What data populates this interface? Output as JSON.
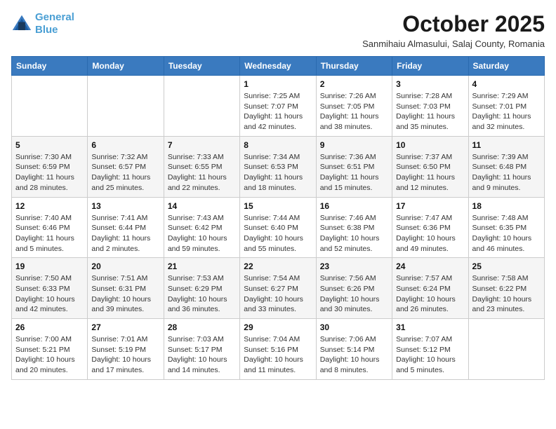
{
  "header": {
    "logo_line1": "General",
    "logo_line2": "Blue",
    "month_title": "October 2025",
    "subtitle": "Sanmihaiu Almasului, Salaj County, Romania"
  },
  "days_of_week": [
    "Sunday",
    "Monday",
    "Tuesday",
    "Wednesday",
    "Thursday",
    "Friday",
    "Saturday"
  ],
  "weeks": [
    [
      {
        "day": "",
        "info": ""
      },
      {
        "day": "",
        "info": ""
      },
      {
        "day": "",
        "info": ""
      },
      {
        "day": "1",
        "info": "Sunrise: 7:25 AM\nSunset: 7:07 PM\nDaylight: 11 hours and 42 minutes."
      },
      {
        "day": "2",
        "info": "Sunrise: 7:26 AM\nSunset: 7:05 PM\nDaylight: 11 hours and 38 minutes."
      },
      {
        "day": "3",
        "info": "Sunrise: 7:28 AM\nSunset: 7:03 PM\nDaylight: 11 hours and 35 minutes."
      },
      {
        "day": "4",
        "info": "Sunrise: 7:29 AM\nSunset: 7:01 PM\nDaylight: 11 hours and 32 minutes."
      }
    ],
    [
      {
        "day": "5",
        "info": "Sunrise: 7:30 AM\nSunset: 6:59 PM\nDaylight: 11 hours and 28 minutes."
      },
      {
        "day": "6",
        "info": "Sunrise: 7:32 AM\nSunset: 6:57 PM\nDaylight: 11 hours and 25 minutes."
      },
      {
        "day": "7",
        "info": "Sunrise: 7:33 AM\nSunset: 6:55 PM\nDaylight: 11 hours and 22 minutes."
      },
      {
        "day": "8",
        "info": "Sunrise: 7:34 AM\nSunset: 6:53 PM\nDaylight: 11 hours and 18 minutes."
      },
      {
        "day": "9",
        "info": "Sunrise: 7:36 AM\nSunset: 6:51 PM\nDaylight: 11 hours and 15 minutes."
      },
      {
        "day": "10",
        "info": "Sunrise: 7:37 AM\nSunset: 6:50 PM\nDaylight: 11 hours and 12 minutes."
      },
      {
        "day": "11",
        "info": "Sunrise: 7:39 AM\nSunset: 6:48 PM\nDaylight: 11 hours and 9 minutes."
      }
    ],
    [
      {
        "day": "12",
        "info": "Sunrise: 7:40 AM\nSunset: 6:46 PM\nDaylight: 11 hours and 5 minutes."
      },
      {
        "day": "13",
        "info": "Sunrise: 7:41 AM\nSunset: 6:44 PM\nDaylight: 11 hours and 2 minutes."
      },
      {
        "day": "14",
        "info": "Sunrise: 7:43 AM\nSunset: 6:42 PM\nDaylight: 10 hours and 59 minutes."
      },
      {
        "day": "15",
        "info": "Sunrise: 7:44 AM\nSunset: 6:40 PM\nDaylight: 10 hours and 55 minutes."
      },
      {
        "day": "16",
        "info": "Sunrise: 7:46 AM\nSunset: 6:38 PM\nDaylight: 10 hours and 52 minutes."
      },
      {
        "day": "17",
        "info": "Sunrise: 7:47 AM\nSunset: 6:36 PM\nDaylight: 10 hours and 49 minutes."
      },
      {
        "day": "18",
        "info": "Sunrise: 7:48 AM\nSunset: 6:35 PM\nDaylight: 10 hours and 46 minutes."
      }
    ],
    [
      {
        "day": "19",
        "info": "Sunrise: 7:50 AM\nSunset: 6:33 PM\nDaylight: 10 hours and 42 minutes."
      },
      {
        "day": "20",
        "info": "Sunrise: 7:51 AM\nSunset: 6:31 PM\nDaylight: 10 hours and 39 minutes."
      },
      {
        "day": "21",
        "info": "Sunrise: 7:53 AM\nSunset: 6:29 PM\nDaylight: 10 hours and 36 minutes."
      },
      {
        "day": "22",
        "info": "Sunrise: 7:54 AM\nSunset: 6:27 PM\nDaylight: 10 hours and 33 minutes."
      },
      {
        "day": "23",
        "info": "Sunrise: 7:56 AM\nSunset: 6:26 PM\nDaylight: 10 hours and 30 minutes."
      },
      {
        "day": "24",
        "info": "Sunrise: 7:57 AM\nSunset: 6:24 PM\nDaylight: 10 hours and 26 minutes."
      },
      {
        "day": "25",
        "info": "Sunrise: 7:58 AM\nSunset: 6:22 PM\nDaylight: 10 hours and 23 minutes."
      }
    ],
    [
      {
        "day": "26",
        "info": "Sunrise: 7:00 AM\nSunset: 5:21 PM\nDaylight: 10 hours and 20 minutes."
      },
      {
        "day": "27",
        "info": "Sunrise: 7:01 AM\nSunset: 5:19 PM\nDaylight: 10 hours and 17 minutes."
      },
      {
        "day": "28",
        "info": "Sunrise: 7:03 AM\nSunset: 5:17 PM\nDaylight: 10 hours and 14 minutes."
      },
      {
        "day": "29",
        "info": "Sunrise: 7:04 AM\nSunset: 5:16 PM\nDaylight: 10 hours and 11 minutes."
      },
      {
        "day": "30",
        "info": "Sunrise: 7:06 AM\nSunset: 5:14 PM\nDaylight: 10 hours and 8 minutes."
      },
      {
        "day": "31",
        "info": "Sunrise: 7:07 AM\nSunset: 5:12 PM\nDaylight: 10 hours and 5 minutes."
      },
      {
        "day": "",
        "info": ""
      }
    ]
  ]
}
